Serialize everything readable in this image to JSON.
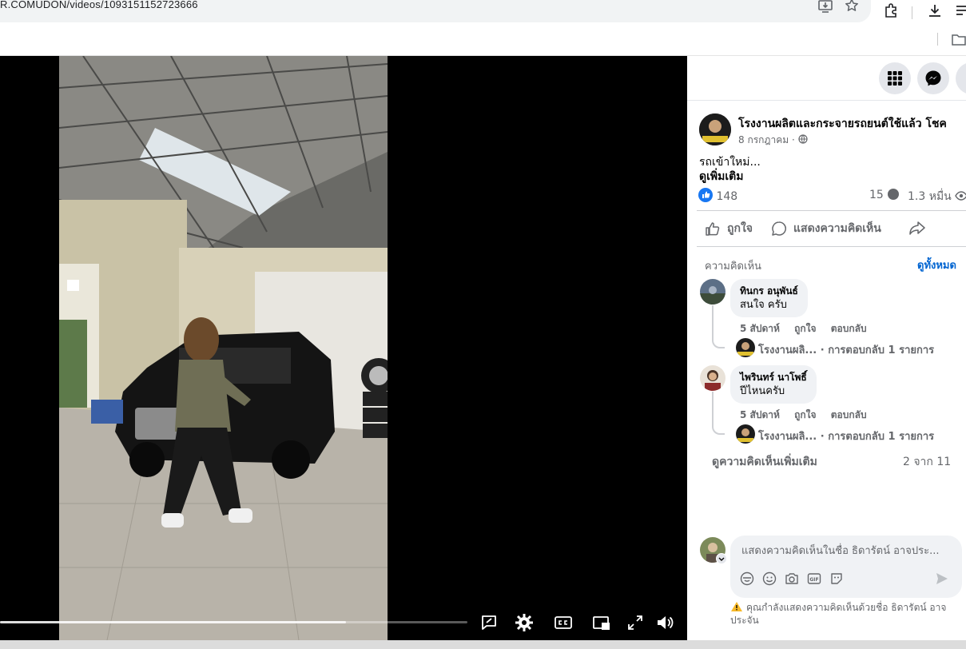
{
  "browser": {
    "url": "R.COMUDON/videos/1093151152723666"
  },
  "post": {
    "page_name": "โรงงานผลิตและกระจายรถยนต์ใช้แล้ว โชค",
    "date": "8 กรกฎาคม · ",
    "text": "รถเข้าใหม่...",
    "see_more": "ดูเพิ่มเติม",
    "likes": "148",
    "comments_count": "15",
    "views": "1.3 หมื่น",
    "actions": {
      "like": "ถูกใจ",
      "comment": "แสดงความคิดเห็น"
    }
  },
  "comments": {
    "heading": "ความคิดเห็น",
    "see_all": "ดูทั้งหมด",
    "items": [
      {
        "name": "ทินกร อนุพันธ์",
        "text": "สนใจ ครับ",
        "time": "5 สัปดาห์",
        "like": "ถูกใจ",
        "reply": "ตอบกลับ",
        "reply_author": "โรงงานผลิ...",
        "reply_count": "· การตอบกลับ 1 รายการ"
      },
      {
        "name": "ไพรินทร์ นาโพธิ์",
        "text": "ปีไหนครับ",
        "time": "5 สัปดาห์",
        "like": "ถูกใจ",
        "reply": "ตอบกลับ",
        "reply_author": "โรงงานผลิ...",
        "reply_count": "· การตอบกลับ 1 รายการ"
      }
    ],
    "more": "ดูความคิดเห็นเพิ่มเติม",
    "page_count": "2 จาก 11"
  },
  "composer": {
    "placeholder": "แสดงความคิดเห็นในชื่อ ธิดารัตน์ อาจประ...",
    "note": "คุณกำลังแสดงความคิดเห็นด้วยชื่อ ธิดารัตน์ อาจประจัน"
  },
  "video": {
    "progress": 0.74
  },
  "colors": {
    "accent": "#0064d1",
    "like_blue": "#1877f2",
    "warning": "#f7b928"
  }
}
